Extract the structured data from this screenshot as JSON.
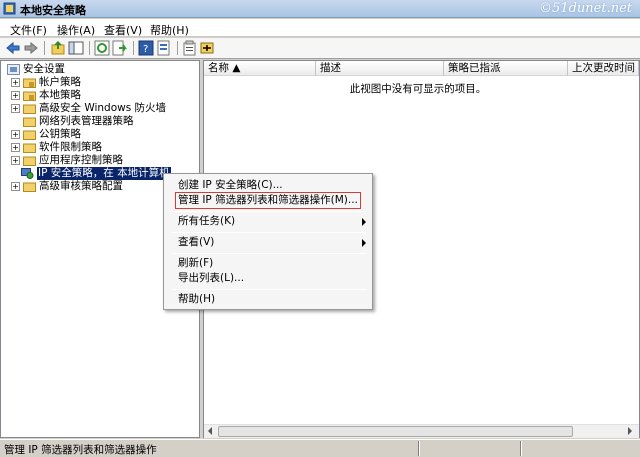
{
  "window": {
    "title": "本地安全策略",
    "watermark": "©51dunet.net"
  },
  "menu": [
    "文件(F)",
    "操作(A)",
    "查看(V)",
    "帮助(H)"
  ],
  "toolbar": {
    "icons": [
      "back-icon",
      "forward-icon",
      "up-icon",
      "show-tree-icon",
      "refresh-icon",
      "export-icon",
      "help-icon",
      "properties-icon",
      "manage-filter-icon",
      "new-policy-icon"
    ]
  },
  "tree": {
    "root": "安全设置",
    "items": [
      {
        "label": "帐户策略",
        "icon": "folder-lock-icon",
        "expandable": true
      },
      {
        "label": "本地策略",
        "icon": "folder-lock-icon",
        "expandable": true
      },
      {
        "label": "高级安全 Windows 防火墙",
        "icon": "folder-icon",
        "expandable": true
      },
      {
        "label": "网络列表管理器策略",
        "icon": "folder-icon",
        "expandable": false
      },
      {
        "label": "公钥策略",
        "icon": "folder-icon",
        "expandable": true
      },
      {
        "label": "软件限制策略",
        "icon": "folder-icon",
        "expandable": true
      },
      {
        "label": "应用程序控制策略",
        "icon": "folder-icon",
        "expandable": true
      },
      {
        "label": "IP 安全策略，在 本地计算机",
        "icon": "ip-policy-icon",
        "expandable": false,
        "selected": true
      },
      {
        "label": "高级审核策略配置",
        "icon": "folder-icon",
        "expandable": true
      }
    ]
  },
  "list": {
    "columns": [
      "名称 ▲",
      "描述",
      "策略已指派",
      "上次更改时间"
    ],
    "empty_text": "此视图中没有可显示的项目。"
  },
  "context_menu": {
    "items": [
      {
        "label": "创建 IP 安全策略(C)..."
      },
      {
        "label": "管理 IP 筛选器列表和筛选器操作(M)...",
        "highlighted": true
      },
      {
        "label": "所有任务(K)",
        "submenu": true
      },
      {
        "label": "查看(V)",
        "submenu": true
      },
      {
        "label": "刷新(F)"
      },
      {
        "label": "导出列表(L)..."
      },
      {
        "label": "帮助(H)"
      }
    ]
  },
  "status": {
    "text": "管理 IP 筛选器列表和筛选器操作"
  },
  "colors": {
    "selection": "#0a246a",
    "highlight_box": "#d83a3a"
  }
}
